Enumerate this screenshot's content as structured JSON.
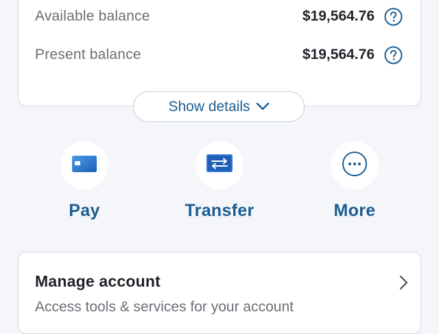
{
  "balances": [
    {
      "label": "Available balance",
      "value": "$19,564.76",
      "icon": "help-icon"
    },
    {
      "label": "Present balance",
      "value": "$19,564.76",
      "icon": "help-icon"
    }
  ],
  "show_details": {
    "label": "Show details",
    "icon": "chevron-down-icon"
  },
  "actions": [
    {
      "label": "Pay",
      "icon": "credit-card-icon"
    },
    {
      "label": "Transfer",
      "icon": "transfer-card-icon"
    },
    {
      "label": "More",
      "icon": "ellipsis-icon"
    }
  ],
  "manage_account": {
    "title": "Manage account",
    "subtitle": "Access tools & services for your account",
    "icon": "chevron-right-icon"
  },
  "colors": {
    "accent": "#1c5d91",
    "icon_blue": "#2f7bd6",
    "background": "#f4f6f9",
    "card": "#ffffff"
  }
}
